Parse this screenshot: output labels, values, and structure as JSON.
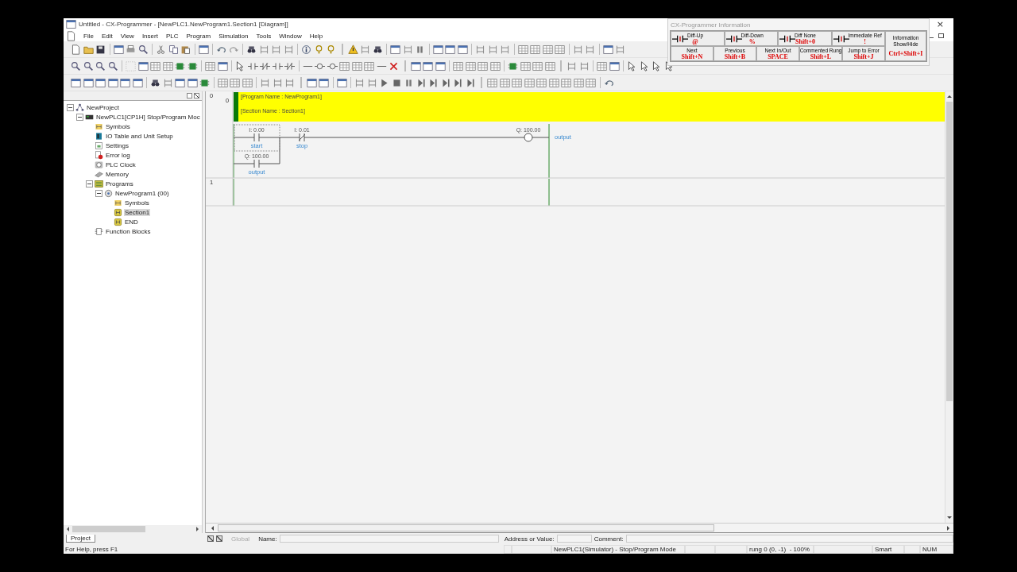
{
  "window": {
    "title": "Untitled - CX-Programmer - [NewPLC1.NewProgram1.Section1 [Diagram]]",
    "close": "×"
  },
  "menu": [
    "File",
    "Edit",
    "View",
    "Insert",
    "PLC",
    "Program",
    "Simulation",
    "Tools",
    "Window",
    "Help"
  ],
  "info_panel": {
    "title": "CX-Programmer Information",
    "buttons": [
      {
        "kind": "contact",
        "label": "Diff-Up",
        "key": "@"
      },
      {
        "kind": "contact",
        "label": "Diff-Down",
        "key": "%"
      },
      {
        "kind": "contact",
        "label": "Diff None",
        "key": "Shift+0"
      },
      {
        "kind": "contact",
        "label": "Immediate Ref",
        "key": "!"
      },
      {
        "kind": "wide",
        "label": "Information Show/Hide",
        "key": "Ctrl+Shift+I"
      },
      {
        "kind": "plain",
        "label": "Next",
        "key": "Shift+N"
      },
      {
        "kind": "plain",
        "label": "Previous",
        "key": "Shift+B"
      },
      {
        "kind": "plain",
        "label": "Next In/Out",
        "key": "SPACE"
      },
      {
        "kind": "plain",
        "label": "Commented Rung",
        "key": "Shift+L"
      },
      {
        "kind": "plain",
        "label": "Jump to Error",
        "key": "Shift+J"
      }
    ]
  },
  "project_tree": {
    "items": [
      {
        "label": "NewProject",
        "kind": "project",
        "selected": false,
        "expanded": true,
        "children": [
          {
            "label": "NewPLC1[CP1H] Stop/Program Moc",
            "kind": "plc",
            "selected": false,
            "expanded": true,
            "children": [
              {
                "label": "Symbols",
                "kind": "symbols",
                "selected": false
              },
              {
                "label": "IO Table and Unit Setup",
                "kind": "iotable",
                "selected": false
              },
              {
                "label": "Settings",
                "kind": "settings",
                "selected": false
              },
              {
                "label": "Error log",
                "kind": "errorlog",
                "selected": false
              },
              {
                "label": "PLC Clock",
                "kind": "clock",
                "selected": false
              },
              {
                "label": "Memory",
                "kind": "memory",
                "selected": false
              },
              {
                "label": "Programs",
                "kind": "programs",
                "selected": false,
                "expanded": true,
                "children": [
                  {
                    "label": "NewProgram1 (00)",
                    "kind": "program",
                    "selected": false,
                    "expanded": true,
                    "children": [
                      {
                        "label": "Symbols",
                        "kind": "symbols",
                        "selected": false
                      },
                      {
                        "label": "Section1",
                        "kind": "section",
                        "selected": true
                      },
                      {
                        "label": "END",
                        "kind": "section",
                        "selected": false
                      }
                    ]
                  }
                ]
              },
              {
                "label": "Function Blocks",
                "kind": "blocks",
                "selected": false
              }
            ]
          }
        ]
      }
    ]
  },
  "ladder": {
    "rungs": [
      {
        "number": "0",
        "step": "0",
        "comment": [
          "[Program Name : NewProgram1]",
          "[Section Name : Section1]"
        ],
        "branches": [
          [
            {
              "kind": "contact_no",
              "address": "I: 0.00",
              "symbol": "start",
              "selected": true
            },
            {
              "kind": "contact_nc",
              "address": "I: 0.01",
              "symbol": "stop",
              "selected": false
            }
          ],
          [
            {
              "kind": "contact_no",
              "address": "Q: 100.00",
              "symbol": "output",
              "selected": false
            }
          ]
        ],
        "coil": {
          "kind": "coil",
          "address": "Q: 100.00",
          "symbol": "output",
          "selected": false
        }
      },
      {
        "number": "1"
      }
    ]
  },
  "bottom_tabs": [
    {
      "label": "Project",
      "selected": true
    }
  ],
  "find_bar": {
    "scope": "Global",
    "name_label": "Name:",
    "address_label": "Address or Value:",
    "comment_label": "Comment:"
  },
  "status_bar": {
    "help": "For Help, press F1",
    "mode": "NewPLC1(Simulator) - Stop/Program Mode",
    "position": "rung 0 (0, -1)  - 100%",
    "edit_mode": "Smart",
    "num": "NUM"
  }
}
